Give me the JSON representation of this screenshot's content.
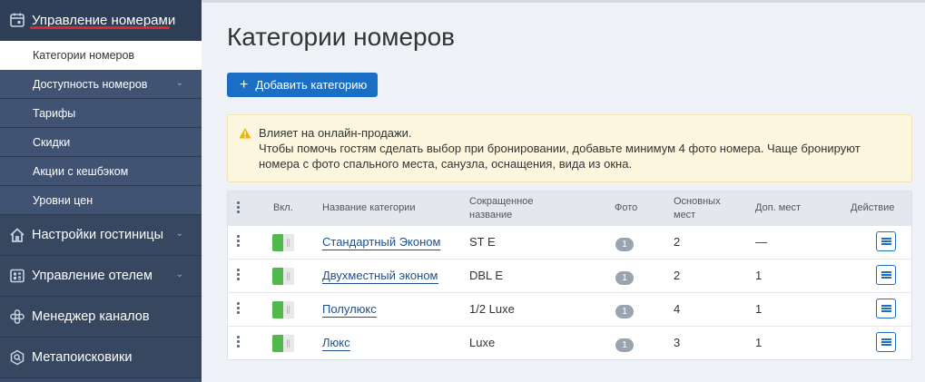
{
  "sidebar": {
    "active_section": "Управление номерами",
    "active_sub": "Категории номеров",
    "subitems": [
      {
        "label": "Доступность номеров",
        "has_chevron": true
      },
      {
        "label": "Тарифы"
      },
      {
        "label": "Скидки"
      },
      {
        "label": "Акции с кешбэком"
      },
      {
        "label": "Уровни цен"
      }
    ],
    "sections": [
      {
        "label": "Настройки гостиницы",
        "icon": "home-icon",
        "has_chevron": true
      },
      {
        "label": "Управление отелем",
        "icon": "hotel-grid-icon",
        "has_chevron": true
      },
      {
        "label": "Менеджер каналов",
        "icon": "channels-icon"
      },
      {
        "label": "Метапоисковики",
        "icon": "metasearch-icon"
      }
    ],
    "accent_color": "#e0262c"
  },
  "page": {
    "title": "Категории номеров",
    "add_button": "Добавить категорию"
  },
  "warning": {
    "line1": "Влияет на онлайн-продажи.",
    "line2": "Чтобы помочь гостям сделать выбор при бронировании, добавьте минимум 4 фото номера. Чаще бронируют",
    "line3": "номера с фото спального места, санузла, оснащения, вида из окна."
  },
  "table": {
    "headers": {
      "enabled": "Вкл.",
      "name": "Название категории",
      "short_1": "Сокращенное",
      "short_2": "название",
      "photo": "Фото",
      "main_1": "Основных",
      "main_2": "мест",
      "extra": "Доп. мест",
      "action": "Действие"
    },
    "rows": [
      {
        "enabled": true,
        "name": "Стандартный Эконом",
        "short": "ST E",
        "photo": "1",
        "main": "2",
        "extra": "—"
      },
      {
        "enabled": true,
        "name": "Двухместный эконом",
        "short": "DBL E",
        "photo": "1",
        "main": "2",
        "extra": "1"
      },
      {
        "enabled": true,
        "name": "Полулюкс",
        "short": "1/2 Luxe",
        "photo": "1",
        "main": "4",
        "extra": "1"
      },
      {
        "enabled": true,
        "name": "Люкс",
        "short": "Luxe",
        "photo": "1",
        "main": "3",
        "extra": "1"
      }
    ]
  }
}
